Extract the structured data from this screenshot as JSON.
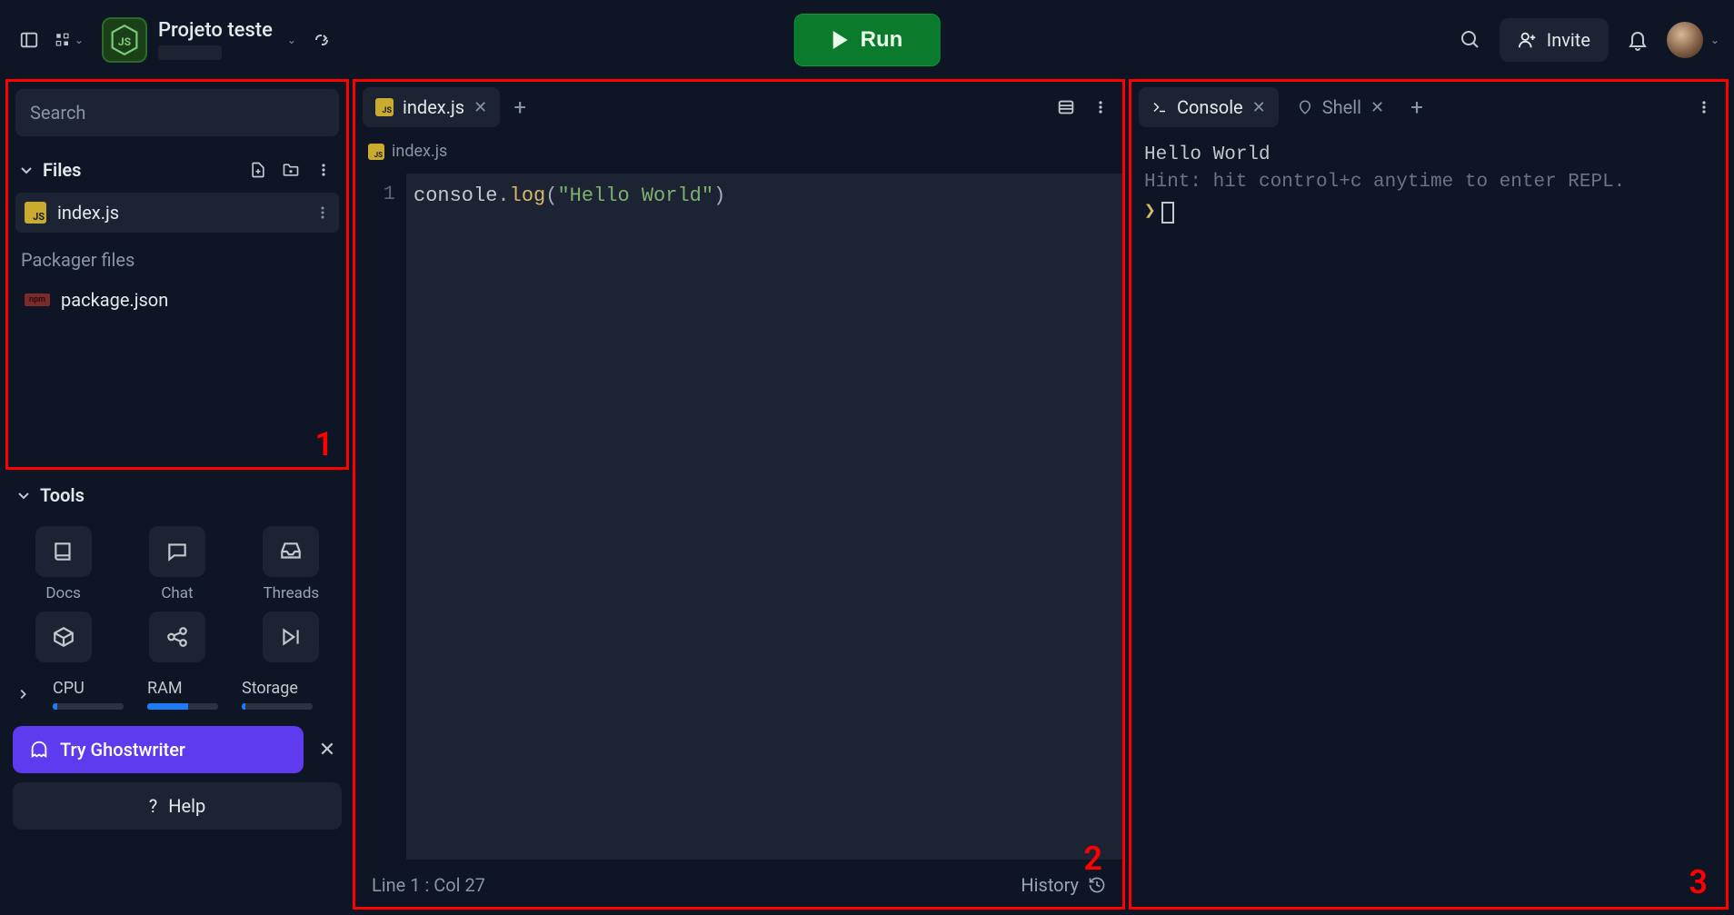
{
  "header": {
    "project_title": "Projeto teste",
    "run_label": "Run",
    "invite_label": "Invite"
  },
  "sidebar": {
    "search_placeholder": "Search",
    "files_label": "Files",
    "files": [
      {
        "name": "index.js"
      }
    ],
    "packager_label": "Packager files",
    "packager_files": [
      {
        "name": "package.json"
      }
    ],
    "tools_label": "Tools",
    "tools": [
      {
        "label": "Docs"
      },
      {
        "label": "Chat"
      },
      {
        "label": "Threads"
      }
    ],
    "resources": {
      "cpu_label": "CPU",
      "cpu_pct": 6,
      "ram_label": "RAM",
      "ram_pct": 58,
      "storage_label": "Storage",
      "storage_pct": 5
    },
    "ghostwriter_label": "Try Ghostwriter",
    "help_label": "Help"
  },
  "editor": {
    "tab_label": "index.js",
    "breadcrumb": "index.js",
    "line_number": "1",
    "code_tokens": {
      "obj": "console",
      "dot": ".",
      "fn": "log",
      "open": "(",
      "str": "\"Hello World\"",
      "close": ")"
    },
    "status": "Line 1 : Col 27",
    "history_label": "History"
  },
  "console": {
    "tab_console": "Console",
    "tab_shell": "Shell",
    "output_line": "Hello World",
    "hint_line": "Hint: hit control+c anytime to enter REPL."
  },
  "regions": {
    "one": "1",
    "two": "2",
    "three": "3"
  }
}
